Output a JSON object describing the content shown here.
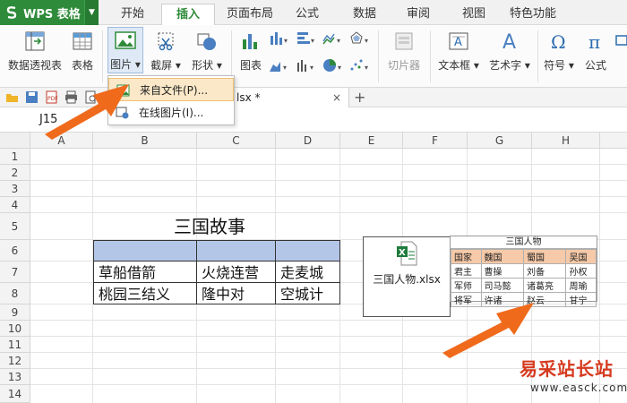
{
  "app": {
    "name": "WPS 表格"
  },
  "tabs": [
    "开始",
    "插入",
    "页面布局",
    "公式",
    "数据",
    "审阅",
    "视图",
    "特色功能"
  ],
  "active_tab": "插入",
  "ribbon": {
    "pivot": "数据透视表",
    "table": "表格",
    "picture": "图片",
    "screenshot": "截屏",
    "shapes": "形状",
    "chart": "图表",
    "slicer": "切片器",
    "textbox": "文本框",
    "wordart": "艺术字",
    "symbol": "符号",
    "formula": "公式"
  },
  "dropdown": {
    "from_file": "来自文件(P)...",
    "online": "在线图片(I)..."
  },
  "doc_tab": {
    "name": "lsx *",
    "close": "×",
    "new": "+"
  },
  "formula_bar": {
    "cell_ref": "J15"
  },
  "grid": {
    "columns": [
      "A",
      "B",
      "C",
      "D",
      "E",
      "F",
      "G",
      "H"
    ],
    "rows": [
      "1",
      "2",
      "3",
      "4",
      "5",
      "6",
      "7",
      "8",
      "9",
      "10",
      "11",
      "12",
      "13",
      "14"
    ]
  },
  "sheet": {
    "title": "三国故事",
    "r7": [
      "草船借箭",
      "火烧连营",
      "走麦城"
    ],
    "r8": [
      "桃园三结义",
      "隆中对",
      "空城计"
    ]
  },
  "file_object": {
    "name": "三国人物.xlsx"
  },
  "mini_table": {
    "title": "三国人物",
    "header": [
      "国家",
      "魏国",
      "蜀国",
      "吴国"
    ],
    "rows": [
      [
        "君主",
        "曹操",
        "刘备",
        "孙权"
      ],
      [
        "军师",
        "司马懿",
        "诸葛亮",
        "周瑜"
      ],
      [
        "将军",
        "许诸",
        "赵云",
        "甘宁"
      ]
    ]
  },
  "watermark": {
    "title": "易采站长站",
    "url": "www.easck.com"
  },
  "colors": {
    "brand": "#2e8b3a",
    "header_fill": "#b4c6e7",
    "arrow": "#f06a1c",
    "mini_header": "#f6c9a8"
  }
}
